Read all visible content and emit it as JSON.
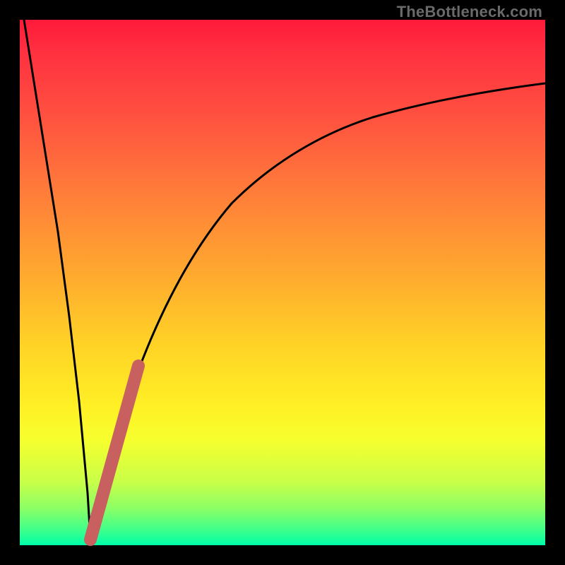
{
  "attribution": "TheBottleneck.com",
  "colors": {
    "frame": "#000000",
    "gradient_top": "#ff1a3a",
    "gradient_bottom": "#00ffa8",
    "curve": "#000000",
    "marker": "#c86060"
  },
  "chart_data": {
    "type": "line",
    "title": "",
    "xlabel": "",
    "ylabel": "",
    "xlim": [
      0,
      100
    ],
    "ylim": [
      0,
      100
    ],
    "series": [
      {
        "name": "bottleneck-curve",
        "x": [
          0,
          3,
          6,
          8,
          10,
          12,
          13,
          14,
          16,
          18,
          20,
          24,
          28,
          34,
          40,
          48,
          56,
          66,
          78,
          90,
          100
        ],
        "values": [
          100,
          78,
          56,
          40,
          24,
          8,
          0,
          3,
          12,
          22,
          31,
          45,
          56,
          67,
          74,
          79,
          82,
          85,
          87,
          88,
          89
        ]
      },
      {
        "name": "highlight-segment",
        "x": [
          12.5,
          14,
          16,
          18,
          20,
          21.5
        ],
        "values": [
          0.5,
          3,
          12,
          22,
          31,
          37
        ]
      }
    ],
    "annotations": []
  }
}
